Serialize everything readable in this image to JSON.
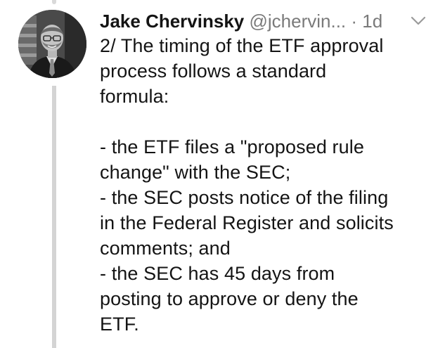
{
  "tweet": {
    "author_name": "Jake Chervinsky",
    "handle": "@jchervin...",
    "separator": "·",
    "time": "1d",
    "text": "2/ The timing of the ETF approval\nprocess follows a standard\nformula:\n\n- the ETF files a \"proposed rule\nchange\" with the SEC;\n- the SEC posts notice of the filing\nin the Federal Register and solicits\ncomments; and\n- the SEC has 45 days from\nposting to approve or deny the\nETF."
  },
  "icons": {
    "avatar": "profile-photo",
    "menu": "chevron-down-icon"
  },
  "colors": {
    "text": "#141414",
    "secondary": "#7a7a7a",
    "thread_line": "#d4d4d4"
  }
}
